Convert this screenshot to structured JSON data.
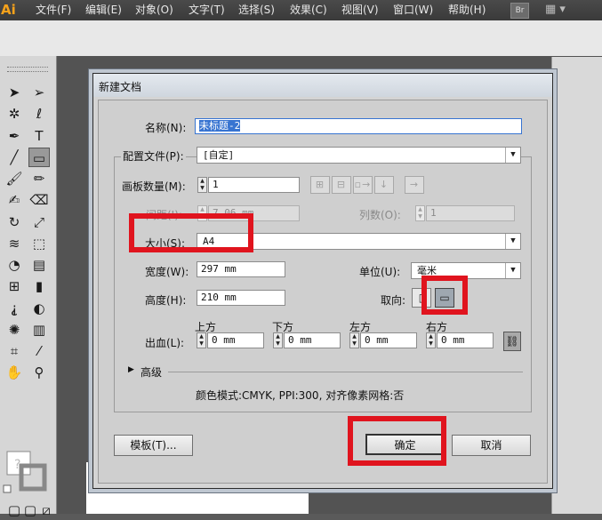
{
  "menubar": {
    "logo": "Ai",
    "items": [
      "文件(F)",
      "编辑(E)",
      "对象(O)",
      "文字(T)",
      "选择(S)",
      "效果(C)",
      "视图(V)",
      "窗口(W)",
      "帮助(H)"
    ],
    "bridge_label": "Br",
    "layout_icon": "▦ ▾"
  },
  "dialog": {
    "title": "新建文档",
    "name_label": "名称(N):",
    "name_value": "未标题-2",
    "profile_label": "配置文件(P):",
    "profile_value": "[自定]",
    "artboards_label": "画板数量(M):",
    "artboards_value": "1",
    "spacing_label": "间距(I):",
    "spacing_value": "7.06 mm",
    "columns_label": "列数(O):",
    "columns_value": "1",
    "size_label": "大小(S):",
    "size_value": "A4",
    "width_label": "宽度(W):",
    "width_value": "297 mm",
    "units_label": "单位(U):",
    "units_value": "毫米",
    "height_label": "高度(H):",
    "height_value": "210 mm",
    "orientation_label": "取向:",
    "orientation_selected": "landscape",
    "bleed_label": "出血(L):",
    "bleed_top_label": "上方",
    "bleed_top_value": "0 mm",
    "bleed_bottom_label": "下方",
    "bleed_bottom_value": "0 mm",
    "bleed_left_label": "左方",
    "bleed_left_value": "0 mm",
    "bleed_right_label": "右方",
    "bleed_right_value": "0 mm",
    "advanced_label": "高级",
    "info": "颜色模式:CMYK, PPI:300, 对齐像素网格:否",
    "templates_button": "模板(T)...",
    "ok_button": "确定",
    "cancel_button": "取消"
  },
  "colors": {
    "highlight": "#e0141e",
    "selection": "#3874d1",
    "logo": "#f7a21b"
  }
}
